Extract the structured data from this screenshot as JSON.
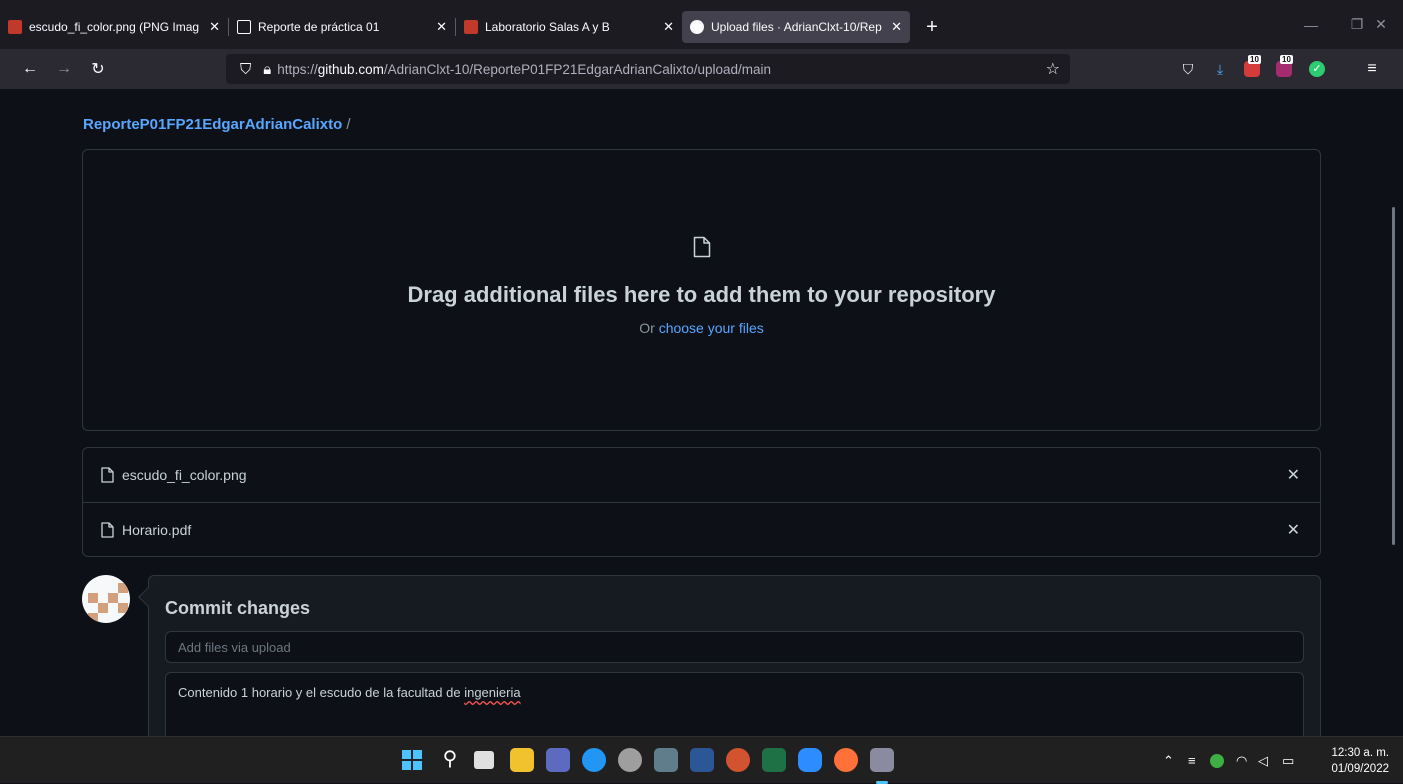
{
  "browser": {
    "tabs": [
      {
        "title": "escudo_fi_color.png (PNG Imag",
        "active": false
      },
      {
        "title": "Reporte de práctica 01",
        "active": false
      },
      {
        "title": "Laboratorio Salas A y B",
        "active": false
      },
      {
        "title": "Upload files · AdrianClxt-10/Rep",
        "active": true
      }
    ],
    "url": {
      "prefix": "https://",
      "host": "github.com",
      "path": "/AdrianClxt-10/ReporteP01FP21EdgarAdrianCalixto/upload/main"
    },
    "badges": {
      "ext1": "10",
      "ext2": "10"
    }
  },
  "page": {
    "breadcrumb": {
      "repo": "ReporteP01FP21EdgarAdrianCalixto",
      "separator": "/"
    },
    "dropzone": {
      "title": "Drag additional files here to add them to your repository",
      "or_text": "Or",
      "choose_link": "choose your files"
    },
    "files": [
      {
        "name": "escudo_fi_color.png"
      },
      {
        "name": "Horario.pdf"
      }
    ],
    "commit": {
      "heading": "Commit changes",
      "summary_placeholder": "Add files via upload",
      "description_prefix": "Contenido 1 horario y el escudo de la facultad de ",
      "description_misspelled": "ingenieria"
    }
  },
  "taskbar": {
    "clock": {
      "time": "12:30 a. m.",
      "date": "01/09/2022"
    }
  }
}
